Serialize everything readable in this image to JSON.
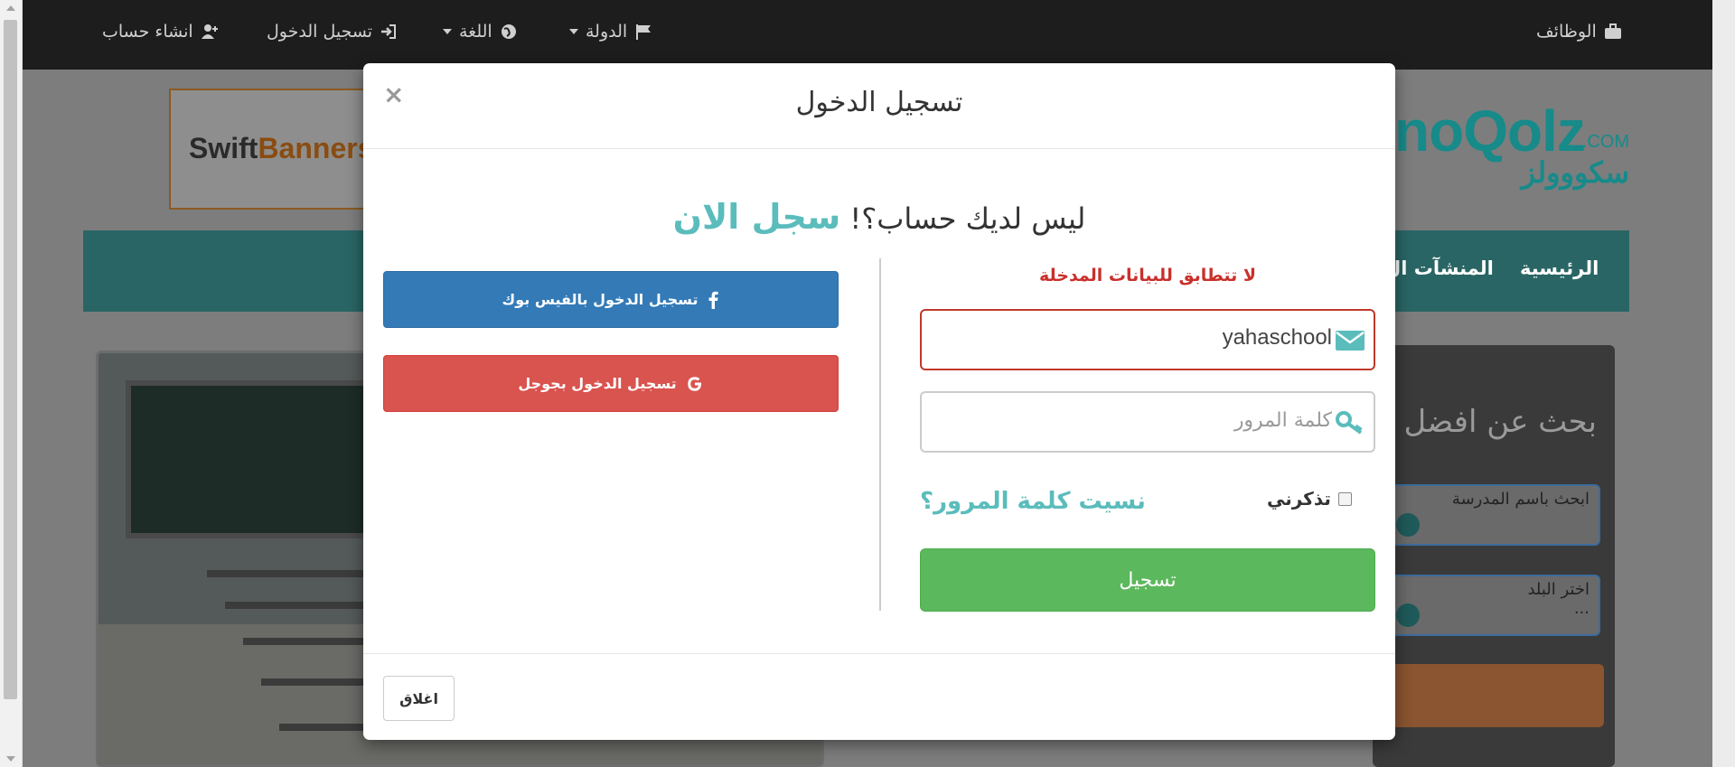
{
  "topnav": {
    "jobs": "الوظائف",
    "country": "الدولة",
    "language": "اللغة",
    "login": "تسجيل الدخول",
    "register": "انشاء حساب"
  },
  "background": {
    "logo_latin": "noQolz",
    "logo_com": ".COM",
    "logo_arabic": "سكووولز",
    "banner_swift": "Swift",
    "banner_banners": "Banners",
    "nav": [
      "الرئيسية",
      "المنشآت ال"
    ],
    "search_title": "بحث عن افضل ا",
    "search_school_placeholder": "ابحث باسم المدرسة",
    "search_country_label": "اختر البلد",
    "search_country_value": "..."
  },
  "modal": {
    "title": "تسجيل الدخول",
    "close_symbol": "×",
    "no_account_text": "ليس لديك حساب؟!",
    "signup_link": "سجل الان",
    "facebook_label": "تسجيل الدخول بالفيس بوك",
    "google_label": "تسجيل الدخول بجوجل",
    "error_message": "لا تتطابق للبيانات المدخلة",
    "username_value": "yahaschool",
    "password_placeholder": "كلمة المرور",
    "remember_label": "تذكرني",
    "forgot_password": "نسيت كلمة المرور؟",
    "submit_label": "تسجيل",
    "footer_close_label": "اغلاق"
  },
  "colors": {
    "accent_teal": "#5bbcbc",
    "facebook_blue": "#337ab7",
    "google_red": "#d9534f",
    "submit_green": "#5cb85c",
    "error_red": "#c9302c"
  },
  "icons": [
    "briefcase-icon",
    "flag-icon",
    "globe-icon",
    "sign-in-icon",
    "user-plus-icon",
    "envelope-icon",
    "key-icon",
    "facebook-icon",
    "google-icon",
    "user-circle-icon"
  ]
}
